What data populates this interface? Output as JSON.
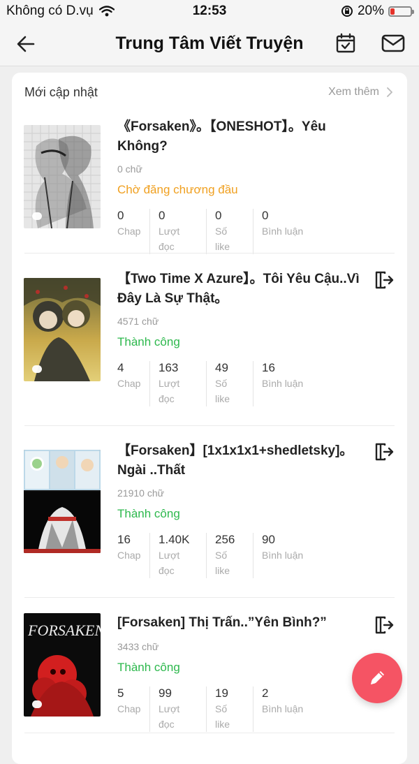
{
  "status_bar": {
    "carrier": "Không có D.vụ",
    "time": "12:53",
    "battery": "20%",
    "battery_level": 0.2
  },
  "header": {
    "title": "Trung Tâm Viết Truyện"
  },
  "section": {
    "title": "Mới cập nhật",
    "more": "Xem thêm"
  },
  "colors": {
    "pending": "#f0a020",
    "success": "#2db84d",
    "fab": "#f55464"
  },
  "stat_labels": {
    "chap": "Chap",
    "reads": "Lượt đọc",
    "likes": "Số like",
    "comments": "Bình luận"
  },
  "stories": [
    {
      "title": "《Forsaken》。【ONESHOT】。Yêu Không?",
      "words": "0 chữ",
      "status": "Chờ đăng chương đầu",
      "status_type": "pending",
      "chap": "0",
      "reads": "0",
      "likes": "0",
      "comments": "0"
    },
    {
      "title": "【Two Time X Azure】。Tôi Yêu Cậu..Vì Đây Là Sự Thật。",
      "words": "4571 chữ",
      "status": "Thành công",
      "status_type": "success",
      "chap": "4",
      "reads": "163",
      "likes": "49",
      "comments": "16"
    },
    {
      "title": "【Forsaken】[1x1x1x1+shedletsky]。Ngài ..Thất",
      "words": "21910 chữ",
      "status": "Thành công",
      "status_type": "success",
      "chap": "16",
      "reads": "1.40K",
      "likes": "256",
      "comments": "90"
    },
    {
      "title": "[Forsaken] Thị Trấn..”Yên Bình?”",
      "words": "3433 chữ",
      "status": "Thành công",
      "status_type": "success",
      "chap": "5",
      "reads": "99",
      "likes": "19",
      "comments": "2"
    }
  ]
}
